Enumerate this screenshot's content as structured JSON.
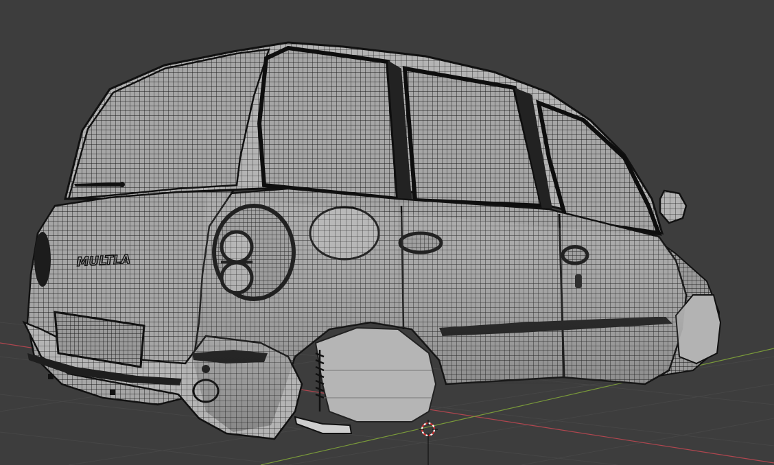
{
  "viewport": {
    "background_color": "#3d3d3d",
    "grid_color": "#464646",
    "x_axis_color": "#b0464f",
    "y_axis_color": "#7a9a3a",
    "wire_color": "#141414",
    "surface_color": "#a9a9a9",
    "origin_icon": "3d-cursor-icon"
  },
  "model": {
    "badge_text": "MULTLA"
  }
}
